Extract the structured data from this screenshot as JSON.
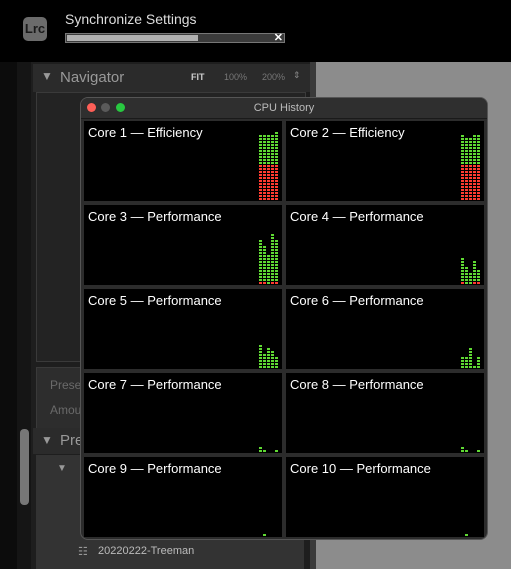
{
  "app": {
    "logo": "Lrc",
    "task_title": "Synchronize Settings",
    "progress_fraction": 0.6,
    "cancel_icon": "close-icon"
  },
  "navigator": {
    "title": "Navigator",
    "zoom_options": [
      "FIT",
      "100%",
      "200%"
    ]
  },
  "section2": {
    "labels": [
      "Preset",
      "Amount"
    ]
  },
  "presets": {
    "title": "Presets",
    "items": [
      "20220222-Treeman"
    ]
  },
  "cpu_window": {
    "title": "CPU History",
    "colors": {
      "user": "#5fd933",
      "system": "#ff3b30",
      "close": "#fe5f57",
      "minimize": "#5a5a5a",
      "zoom": "#28c840"
    },
    "cores": [
      {
        "name": "Core 1 — Efficiency",
        "segments": [
          22,
          22,
          22,
          22,
          23
        ],
        "system_segments": [
          12,
          12,
          12,
          12,
          12
        ]
      },
      {
        "name": "Core 2 — Efficiency",
        "segments": [
          22,
          21,
          21,
          22,
          22
        ],
        "system_segments": [
          12,
          12,
          12,
          12,
          12
        ]
      },
      {
        "name": "Core 3 — Performance",
        "segments": [
          15,
          13,
          10,
          17,
          15
        ],
        "system_segments": [
          1,
          1,
          0,
          1,
          1
        ]
      },
      {
        "name": "Core 4 — Performance",
        "segments": [
          9,
          6,
          4,
          8,
          5
        ],
        "system_segments": [
          1,
          0,
          0,
          1,
          1
        ]
      },
      {
        "name": "Core 5 — Performance",
        "segments": [
          8,
          5,
          7,
          6,
          4
        ],
        "system_segments": [
          0,
          0,
          0,
          0,
          0
        ]
      },
      {
        "name": "Core 6 — Performance",
        "segments": [
          4,
          4,
          7,
          1,
          4
        ],
        "system_segments": [
          0,
          0,
          0,
          0,
          0
        ]
      },
      {
        "name": "Core 7 — Performance",
        "segments": [
          2,
          1,
          0,
          0,
          1
        ],
        "system_segments": [
          0,
          0,
          0,
          0,
          0
        ]
      },
      {
        "name": "Core 8 — Performance",
        "segments": [
          2,
          1,
          0,
          0,
          1
        ],
        "system_segments": [
          0,
          0,
          0,
          0,
          0
        ]
      },
      {
        "name": "Core 9 — Performance",
        "segments": [
          0,
          1,
          0,
          0,
          0
        ],
        "system_segments": [
          0,
          0,
          0,
          0,
          0
        ]
      },
      {
        "name": "Core 10 — Performance",
        "segments": [
          0,
          1,
          0,
          0,
          0
        ],
        "system_segments": [
          0,
          0,
          0,
          0,
          0
        ]
      }
    ]
  }
}
